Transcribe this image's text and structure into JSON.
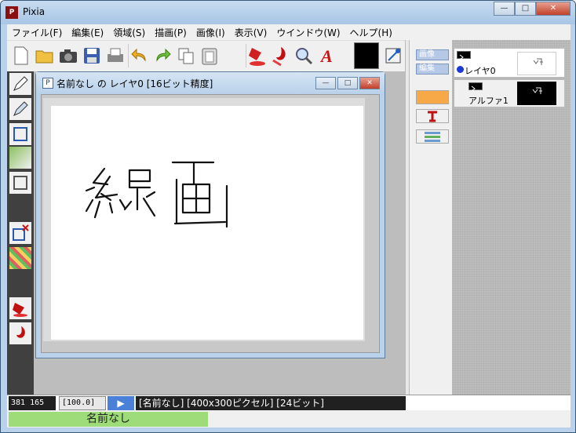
{
  "window": {
    "title": "Pixia",
    "minimize": "—",
    "maximize": "□",
    "close": "✕",
    "icon_text": "P"
  },
  "menu": [
    "ファイル(F)",
    "編集(E)",
    "領域(S)",
    "描画(P)",
    "画像(I)",
    "表示(V)",
    "ウインドウ(W)",
    "ヘルプ(H)"
  ],
  "toolbar_icons": [
    "new-icon",
    "open-icon",
    "camera-icon",
    "save-icon",
    "print-icon",
    "undo-icon",
    "redo-icon",
    "copy-icon",
    "paste-icon",
    "fill-bucket-icon",
    "fill-icon",
    "zoom-icon",
    "text-icon",
    "color-swatch",
    "transform-icon"
  ],
  "document": {
    "title": "名前なし の レイヤ0 [16ビット精度]",
    "icon_text": "P",
    "drawing": "線画"
  },
  "right_panel": {
    "tab_image": "画像",
    "tab_edit": "編集"
  },
  "layers": [
    {
      "name": "レイヤ0",
      "active": true
    },
    {
      "name": "アルファ1",
      "active": false
    }
  ],
  "status": {
    "coords": "381 165",
    "zoom": "[100.0]",
    "info": "[名前なし] [400x300ピクセル] [24ビット]",
    "docname": "名前なし"
  },
  "colors": {
    "accent": "#4a80d8",
    "docname_bg": "#9ddc79",
    "orange": "#f7a847"
  }
}
